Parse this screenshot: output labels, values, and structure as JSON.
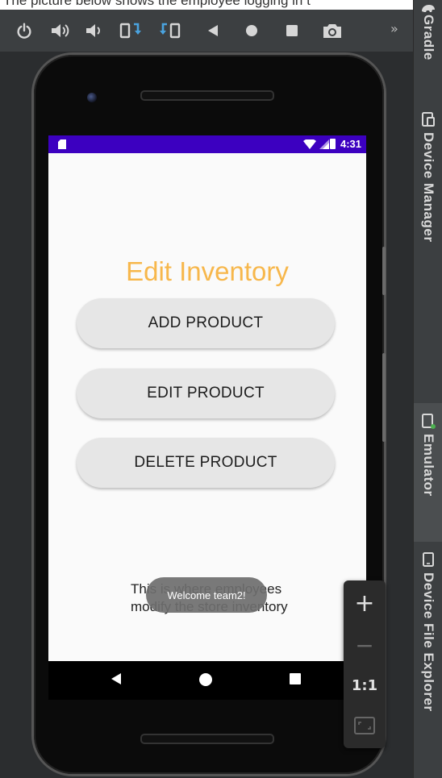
{
  "caption": "The picture below shows the employee logging in t",
  "toolbar": {
    "icons": [
      "power-icon",
      "volume-up-icon",
      "volume-down-icon",
      "rotate-left-icon",
      "rotate-right-icon",
      "back-icon",
      "home-icon",
      "overview-icon",
      "camera-icon"
    ],
    "more": "»"
  },
  "right_panel": {
    "items": [
      {
        "label": "Gradle",
        "icon": "elephant-icon"
      },
      {
        "label": "Device Manager",
        "icon": "device-manager-icon"
      },
      {
        "label": "Emulator",
        "icon": "emulator-icon",
        "active": true
      },
      {
        "label": "Device File Explorer",
        "icon": "device-file-explorer-icon"
      }
    ]
  },
  "status_bar": {
    "time": "4:31",
    "color": "#3c00c0"
  },
  "screen": {
    "title": "Edit Inventory",
    "title_color": "#f7b74b",
    "buttons": [
      "ADD PRODUCT",
      "EDIT PRODUCT",
      "DELETE PRODUCT"
    ],
    "description": "This is where employees modify the store inventory",
    "toast": "Welcome team2!"
  },
  "zoom_panel": {
    "zoom_in": "+",
    "zoom_out": "−",
    "actual_size": "1:1"
  }
}
